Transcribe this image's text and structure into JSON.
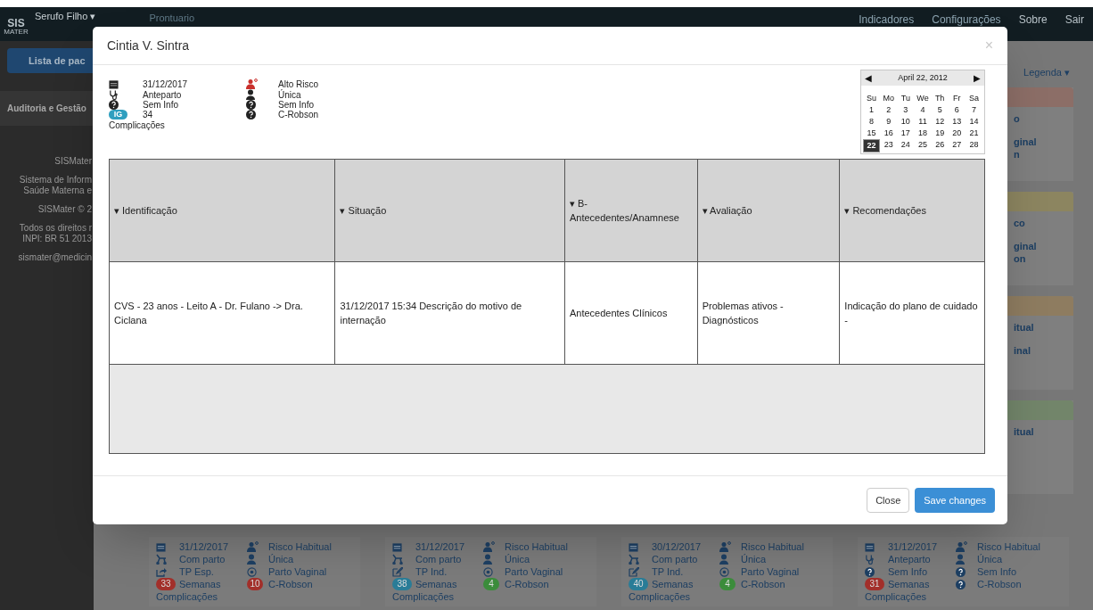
{
  "navbar": {
    "logo_top": "SIS",
    "logo_bottom": "MATER",
    "user": "Serufo Filho ▾",
    "section": "Prontuario",
    "links": [
      "Indicadores",
      "Configurações",
      "Sobre",
      "Sair"
    ]
  },
  "sidebar": {
    "button": "Lista de pac",
    "menu_item": "Auditoria e Gestão",
    "footer": [
      "SISMater",
      "Sistema de Inform",
      "Saúde Materna e",
      "SISMater © 2",
      "Todos os direitos r",
      "INPI: BR 51 2013",
      "sismater@medicin"
    ]
  },
  "legend_button": "Legenda ▾",
  "side_cards": [
    {
      "color": "#8c6e67",
      "lines": [
        "o",
        "ginal",
        "n"
      ]
    },
    {
      "color": "#8c8560",
      "lines": [
        "co",
        "ginal",
        "on"
      ]
    },
    {
      "color": "#8e7c60",
      "lines": [
        "itual",
        "inal"
      ]
    },
    {
      "color": "#72856a",
      "lines": [
        "itual"
      ]
    }
  ],
  "bottom_cards": [
    {
      "date": "31/12/2017",
      "risk": "Risco Habitual",
      "stage": {
        "kind": "stroller",
        "text": "Com parto"
      },
      "pregnancy": "Única",
      "labor": {
        "kind": "share",
        "text": "TP Esp."
      },
      "delivery": {
        "kind": "target",
        "text": "Parto Vaginal"
      },
      "weeks": {
        "text": "33",
        "color": "#a3302b"
      },
      "weeks_label": "Semanas",
      "robson": {
        "kind": "badge",
        "value": "10",
        "color": "#a3302b",
        "text": "C-Robson"
      },
      "complications": "Complicações"
    },
    {
      "date": "31/12/2017",
      "risk": "Risco Habitual",
      "stage": {
        "kind": "stroller",
        "text": "Com parto"
      },
      "pregnancy": "Única",
      "labor": {
        "kind": "edit",
        "text": "TP Ind."
      },
      "delivery": {
        "kind": "target",
        "text": "Parto Vaginal"
      },
      "weeks": {
        "text": "38",
        "color": "#2a7d98"
      },
      "weeks_label": "Semanas",
      "robson": {
        "kind": "badge",
        "value": "4",
        "color": "#3c8d3c",
        "text": "C-Robson"
      },
      "complications": "Complicações"
    },
    {
      "date": "30/12/2017",
      "risk": "Risco Habitual",
      "stage": {
        "kind": "stroller",
        "text": "Com parto"
      },
      "pregnancy": "Única",
      "labor": {
        "kind": "edit",
        "text": "TP Ind."
      },
      "delivery": {
        "kind": "target",
        "text": "Parto Vaginal"
      },
      "weeks": {
        "text": "40",
        "color": "#2a7d98"
      },
      "weeks_label": "Semanas",
      "robson": {
        "kind": "badge",
        "value": "4",
        "color": "#3c8d3c",
        "text": "C-Robson"
      },
      "complications": "Complicações"
    },
    {
      "date": "31/12/2017",
      "risk": "Risco Habitual",
      "stage": {
        "kind": "stethoscope",
        "text": "Anteparto"
      },
      "pregnancy": "Única",
      "labor": {
        "kind": "question",
        "text": "Sem Info"
      },
      "delivery": {
        "kind": "question",
        "text": "Sem Info"
      },
      "weeks": {
        "text": "31",
        "color": "#a3302b"
      },
      "weeks_label": "Semanas",
      "robson": {
        "kind": "question",
        "text": "C-Robson"
      },
      "complications": "Complicações"
    }
  ],
  "modal": {
    "title": "Cintia V. Sintra",
    "close_symbol": "×",
    "info": {
      "date": "31/12/2017",
      "stage": "Anteparto",
      "labor": "Sem Info",
      "ig_badge": "IG",
      "weeks": "34",
      "complications": "Complicações",
      "risk": "Alto Risco",
      "pregnancy": "Única",
      "delivery": "Sem Info",
      "robson": "C-Robson"
    },
    "calendar": {
      "prev": "◀",
      "title": "April 22, 2012",
      "next": "▶",
      "weekdays": [
        "Su",
        "Mo",
        "Tu",
        "We",
        "Th",
        "Fr",
        "Sa"
      ],
      "weeks": [
        [
          {
            "day": "1",
            "selected": false
          },
          {
            "day": "2",
            "selected": false
          },
          {
            "day": "3",
            "selected": false
          },
          {
            "day": "4",
            "selected": false
          },
          {
            "day": "5",
            "selected": false
          },
          {
            "day": "6",
            "selected": false
          },
          {
            "day": "7",
            "selected": false
          }
        ],
        [
          {
            "day": "8",
            "selected": false
          },
          {
            "day": "9",
            "selected": false
          },
          {
            "day": "10",
            "selected": false
          },
          {
            "day": "11",
            "selected": false
          },
          {
            "day": "12",
            "selected": false
          },
          {
            "day": "13",
            "selected": false
          },
          {
            "day": "14",
            "selected": false
          }
        ],
        [
          {
            "day": "15",
            "selected": false
          },
          {
            "day": "16",
            "selected": false
          },
          {
            "day": "17",
            "selected": false
          },
          {
            "day": "18",
            "selected": false
          },
          {
            "day": "19",
            "selected": false
          },
          {
            "day": "20",
            "selected": false
          },
          {
            "day": "21",
            "selected": false
          }
        ],
        [
          {
            "day": "22",
            "selected": true
          },
          {
            "day": "23",
            "selected": false
          },
          {
            "day": "24",
            "selected": false
          },
          {
            "day": "25",
            "selected": false
          },
          {
            "day": "26",
            "selected": false
          },
          {
            "day": "27",
            "selected": false
          },
          {
            "day": "28",
            "selected": false
          }
        ]
      ]
    },
    "table": {
      "columns": [
        "▾ Identificação",
        "▾ Situação",
        "▾ B-Antecedentes/Anamnese",
        "▾ Avaliação",
        "▾ Recomendações"
      ],
      "rows": [
        [
          "CVS - 23 anos - Leito A - Dr. Fulano -> Dra. Ciclana",
          "31/12/2017 15:34 Descrição do motivo de internação",
          "Antecedentes Clínicos",
          "Problemas ativos - Diagnósticos",
          "Indicação do plano de cuidado -"
        ]
      ]
    },
    "buttons": {
      "close": "Close",
      "save": "Save changes"
    }
  }
}
